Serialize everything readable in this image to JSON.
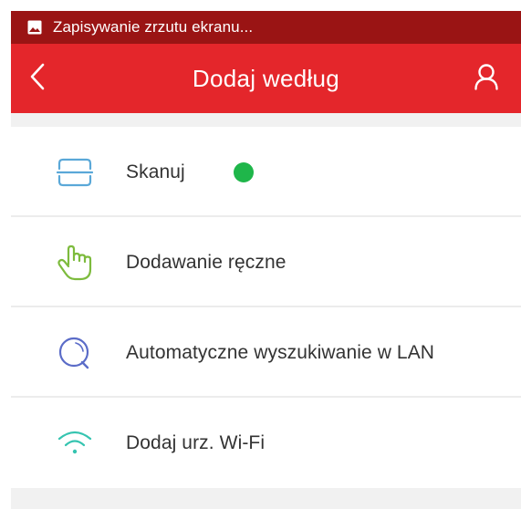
{
  "status_bar": {
    "notification_text": "Zapisywanie zrzutu ekranu...",
    "icon": "image-icon"
  },
  "header": {
    "title": "Dodaj według",
    "back_icon": "chevron-left-icon",
    "user_icon": "user-icon"
  },
  "menu": {
    "items": [
      {
        "label": "Skanuj",
        "icon": "scan-icon",
        "status_color": "#1fb64a"
      },
      {
        "label": "Dodawanie ręczne",
        "icon": "hand-pointer-icon"
      },
      {
        "label": "Automatyczne wyszukiwanie w LAN",
        "icon": "search-lan-icon"
      },
      {
        "label": "Dodaj urz. Wi-Fi",
        "icon": "wifi-icon"
      }
    ]
  },
  "colors": {
    "header_red": "#e4262b",
    "status_bar_dark_red": "#9a1414",
    "scan_icon_blue": "#5aa8d8",
    "manual_icon_green": "#7dbb3d",
    "lan_icon_indigo": "#5b6cc8",
    "wifi_icon_teal": "#35c4b0"
  }
}
